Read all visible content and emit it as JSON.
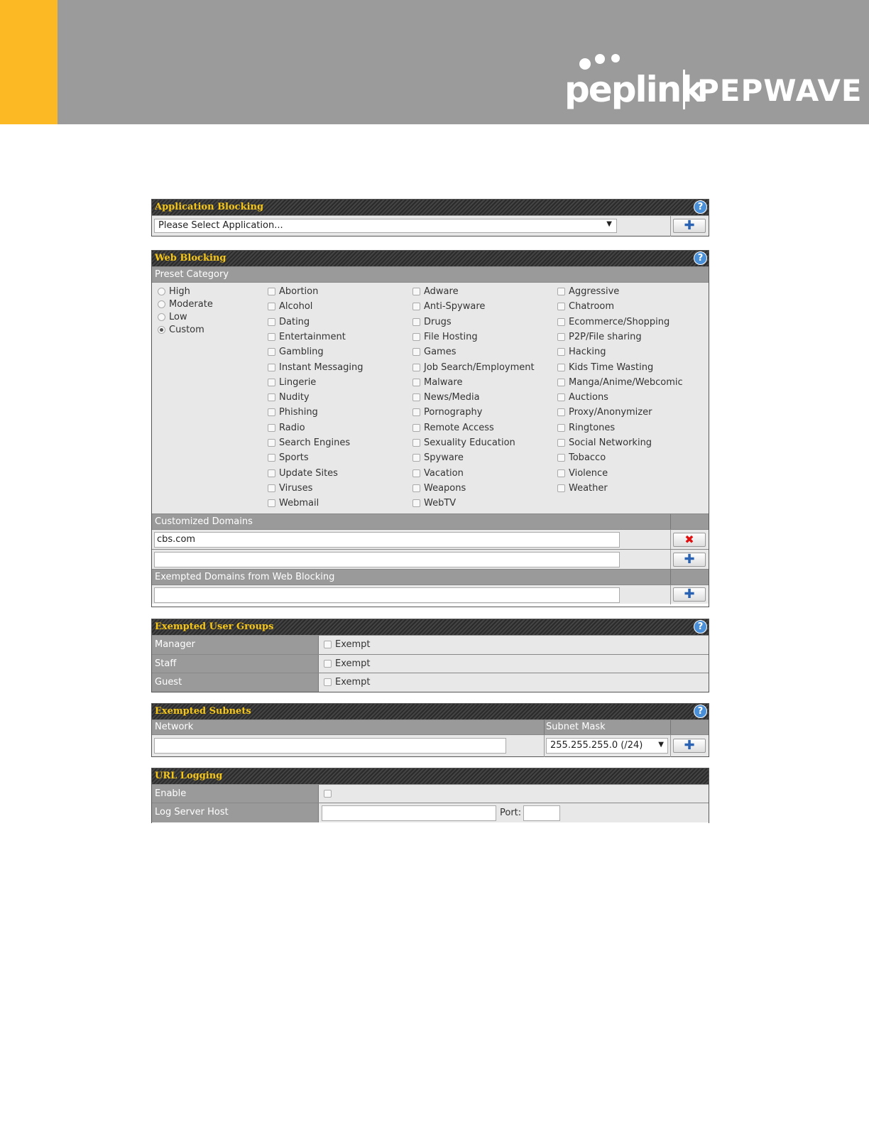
{
  "brand": {
    "logo_text": "peplink",
    "logo_text_2": "PEPWAVE"
  },
  "application_blocking": {
    "title": "Application Blocking",
    "select_value": "Please Select Application...",
    "add_icon": "plus-icon"
  },
  "web_blocking": {
    "title": "Web Blocking",
    "preset_label": "Preset Category",
    "presets": [
      {
        "label": "High",
        "selected": false
      },
      {
        "label": "Moderate",
        "selected": false
      },
      {
        "label": "Low",
        "selected": false
      },
      {
        "label": "Custom",
        "selected": true
      }
    ],
    "categories_col1": [
      "Abortion",
      "Alcohol",
      "Dating",
      "Entertainment",
      "Gambling",
      "Instant Messaging",
      "Lingerie",
      "Nudity",
      "Phishing",
      "Radio",
      "Search Engines",
      "Sports",
      "Update Sites",
      "Viruses",
      "Webmail"
    ],
    "categories_col2": [
      "Adware",
      "Anti-Spyware",
      "Drugs",
      "File Hosting",
      "Games",
      "Job Search/Employment",
      "Malware",
      "News/Media",
      "Pornography",
      "Remote Access",
      "Sexuality Education",
      "Spyware",
      "Vacation",
      "Weapons",
      "WebTV"
    ],
    "categories_col3": [
      "Aggressive",
      "Chatroom",
      "Ecommerce/Shopping",
      "P2P/File sharing",
      "Hacking",
      "Kids Time Wasting",
      "Manga/Anime/Webcomic",
      "Auctions",
      "Proxy/Anonymizer",
      "Ringtones",
      "Social Networking",
      "Tobacco",
      "Violence",
      "Weather"
    ],
    "customized_label": "Customized Domains",
    "customized_value": "cbs.com",
    "exempted_label": "Exempted Domains from Web Blocking"
  },
  "exempted_user_groups": {
    "title": "Exempted User Groups",
    "rows": [
      {
        "label": "Manager",
        "option": "Exempt"
      },
      {
        "label": "Staff",
        "option": "Exempt"
      },
      {
        "label": "Guest",
        "option": "Exempt"
      }
    ]
  },
  "exempted_subnets": {
    "title": "Exempted Subnets",
    "network_label": "Network",
    "mask_label": "Subnet Mask",
    "mask_value": "255.255.255.0 (/24)"
  },
  "url_logging": {
    "title": "URL Logging",
    "enable_label": "Enable",
    "host_label": "Log Server Host",
    "port_label": "Port:"
  }
}
